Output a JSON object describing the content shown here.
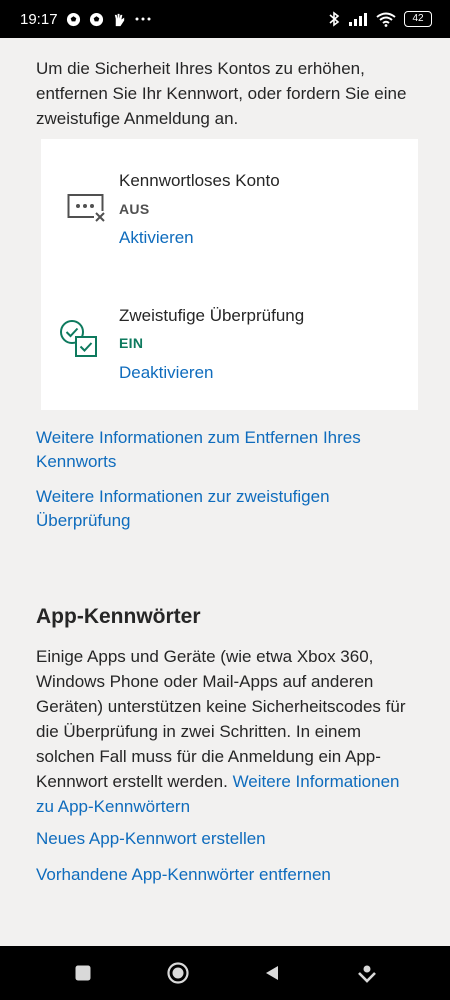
{
  "status_bar": {
    "time": "19:17",
    "battery": "42",
    "notification_icons": [
      "soccer-ball-icon",
      "soccer-ball-icon",
      "hand-icon",
      "more-icon"
    ],
    "system_icons": [
      "bluetooth-icon",
      "signal-icon",
      "wifi-icon",
      "battery-icon"
    ]
  },
  "intro_text": "Um die Sicherheit Ihres Kontos zu erhöhen, entfernen Sie Ihr Kennwort, oder fordern Sie eine zweistufige Anmeldung an.",
  "methods": [
    {
      "title": "Kennwortloses Konto",
      "status": "AUS",
      "status_color": "#505050",
      "action": "Aktivieren",
      "icon": "passwordless-icon"
    },
    {
      "title": "Zweistufige Überprüfung",
      "status": "EIN",
      "status_color": "#0e7a5e",
      "action": "Deaktivieren",
      "icon": "two-step-verification-icon"
    }
  ],
  "links": {
    "remove_password_info": "Weitere Informationen zum Entfernen Ihres Kennworts",
    "two_step_info": "Weitere Informationen zur zweistufigen Überprüfung"
  },
  "app_passwords": {
    "heading": "App-Kennwörter",
    "body": "Einige Apps und Geräte (wie etwa Xbox 360, Windows Phone oder Mail-Apps auf anderen Geräten) unterstützen keine Sicherheitscodes für die Überprüfung in zwei Schritten. In einem solchen Fall muss für die Anmeldung ein App-Kennwort erstellt werden.",
    "body_link": "Weitere Informationen zu App-Kennwörtern",
    "create_link": "Neues App-Kennwort erstellen",
    "remove_link": "Vorhandene App-Kennwörter entfernen"
  },
  "colors": {
    "link": "#0f6cbd",
    "accent_green": "#0e7a5e",
    "background": "#f2f1f0",
    "card": "#ffffff"
  }
}
